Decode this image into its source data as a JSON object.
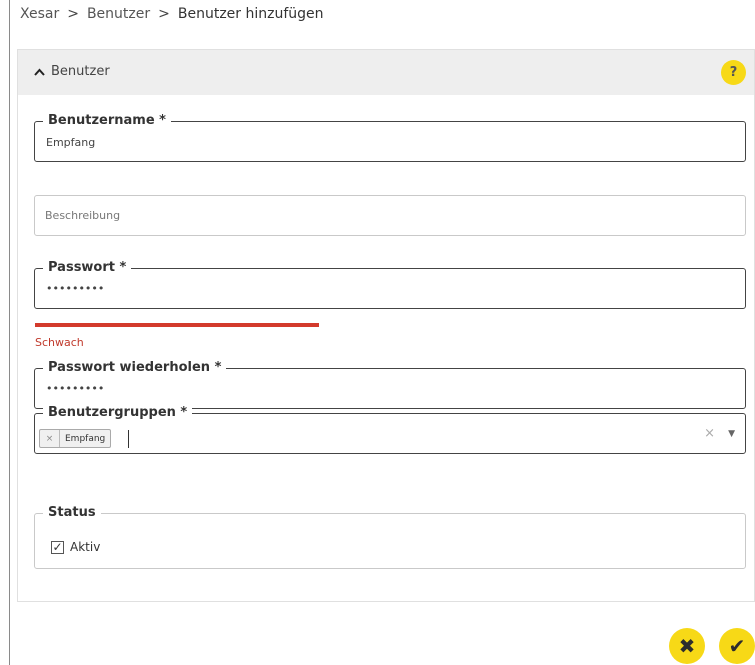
{
  "breadcrumb": {
    "items": [
      "Xesar",
      "Benutzer",
      "Benutzer hinzufügen"
    ],
    "separator": ">"
  },
  "panel": {
    "title": "Benutzer",
    "collapse_icon": "chevron-up-icon",
    "help_label": "?"
  },
  "fields": {
    "username": {
      "label": "Benutzername *",
      "value": "Empfang"
    },
    "description": {
      "placeholder": "Beschreibung"
    },
    "password": {
      "label": "Passwort *",
      "value": "•••••••••"
    },
    "password_strength": {
      "label": "Schwach",
      "color": "#d33a2c"
    },
    "password_repeat": {
      "label": "Passwort wiederholen *",
      "value": "•••••••••"
    },
    "user_groups": {
      "label": "Benutzergruppen *",
      "selected_tag": "Empfang",
      "tag_remove": "×",
      "clear": "×",
      "dropdown_arrow": "▼"
    },
    "status": {
      "label": "Status",
      "checkbox_label": "Aktiv",
      "checked": true,
      "check_mark": "✓"
    }
  },
  "actions": {
    "cancel_icon": "✖",
    "confirm_icon": "✔"
  },
  "colors": {
    "accent": "#f7d917",
    "header_bg": "#eeeeee",
    "error": "#d33a2c"
  }
}
